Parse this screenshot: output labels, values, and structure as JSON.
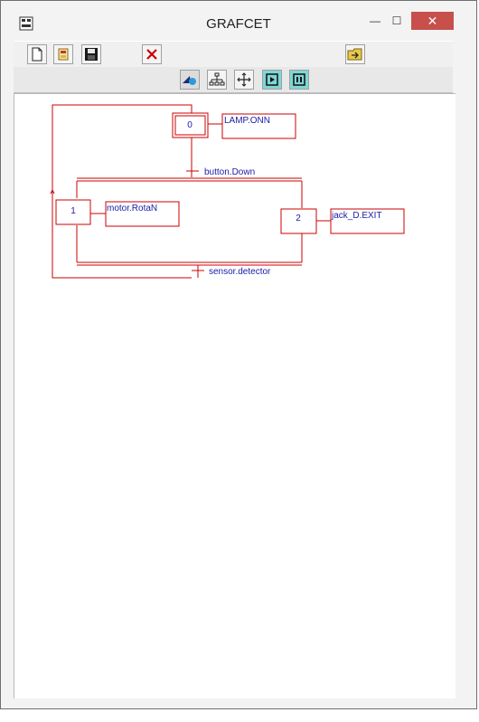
{
  "window": {
    "title": "GRAFCET",
    "min_symbol": "—",
    "max_symbol": "☐",
    "close_symbol": "✕"
  },
  "toolbar1": {
    "buttons": [
      {
        "name": "new-button",
        "icon": "new-document-icon"
      },
      {
        "name": "open-button",
        "icon": "open-folder-icon"
      },
      {
        "name": "save-button",
        "icon": "floppy-disk-icon"
      },
      {
        "name": "delete-button",
        "icon": "red-x-icon"
      },
      {
        "name": "export-button",
        "icon": "folder-arrow-icon"
      }
    ]
  },
  "toolbar2": {
    "buttons": [
      {
        "name": "select-tool-button",
        "icon": "cursor-shape-icon"
      },
      {
        "name": "hierarchy-tool-button",
        "icon": "tree-structure-icon"
      },
      {
        "name": "move-tool-button",
        "icon": "four-arrows-icon"
      },
      {
        "name": "run-button",
        "icon": "play-icon"
      },
      {
        "name": "pause-button",
        "icon": "pause-icon"
      }
    ]
  },
  "grafcet": {
    "steps": [
      {
        "id": "0",
        "initial": true
      },
      {
        "id": "1",
        "initial": false
      },
      {
        "id": "2",
        "initial": false
      }
    ],
    "actions": [
      {
        "step": "0",
        "label": "LAMP.ONN"
      },
      {
        "step": "1",
        "label": "motor.RotaN"
      },
      {
        "step": "2",
        "label": "jack_D.EXIT"
      }
    ],
    "transitions": [
      {
        "label": "button.Down"
      },
      {
        "label": "sensor.detector"
      }
    ]
  },
  "colors": {
    "diagram_line": "#cc0000",
    "diagram_text": "#1a1aa8",
    "close_button": "#c7504c"
  }
}
